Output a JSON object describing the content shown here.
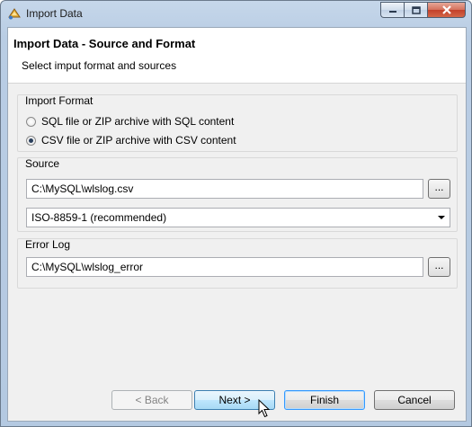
{
  "window": {
    "title": "Import Data"
  },
  "banner": {
    "title": "Import Data - Source and Format",
    "subtitle": "Select imput format and sources"
  },
  "import_format": {
    "label": "Import Format",
    "options": [
      {
        "label": "SQL file or ZIP archive with SQL content",
        "selected": false
      },
      {
        "label": "CSV file or ZIP archive with CSV content",
        "selected": true
      }
    ]
  },
  "source": {
    "label": "Source",
    "path": "C:\\MySQL\\wlslog.csv",
    "browse_label": "...",
    "encoding": "ISO-8859-1 (recommended)"
  },
  "error_log": {
    "label": "Error Log",
    "path": "C:\\MySQL\\wlslog_error",
    "browse_label": "..."
  },
  "buttons": {
    "back": "< Back",
    "next": "Next >",
    "finish": "Finish",
    "cancel": "Cancel"
  }
}
